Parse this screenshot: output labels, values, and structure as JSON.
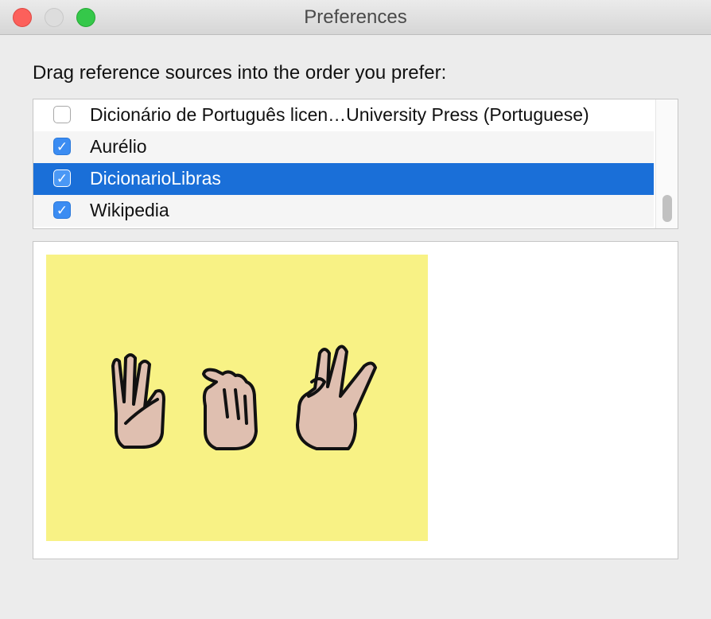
{
  "window": {
    "title": "Preferences"
  },
  "instruction": "Drag reference sources into the order you prefer:",
  "sources": [
    {
      "label": "Dicionário de Português licen…University Press (Portuguese)",
      "checked": false,
      "selected": false
    },
    {
      "label": "Aurélio",
      "checked": true,
      "selected": false
    },
    {
      "label": "DicionarioLibras",
      "checked": true,
      "selected": true
    },
    {
      "label": "Wikipedia",
      "checked": true,
      "selected": false
    }
  ],
  "checkmark_glyph": "✓",
  "preview": {
    "image": "libras-hand-signs",
    "background_color": "#f8f285",
    "hand_fill": "#dfbfb0"
  },
  "colors": {
    "selection": "#1a6fd8",
    "checkbox_on": "#3b8cf2",
    "close": "#fc605b",
    "maximize": "#35c84a"
  }
}
